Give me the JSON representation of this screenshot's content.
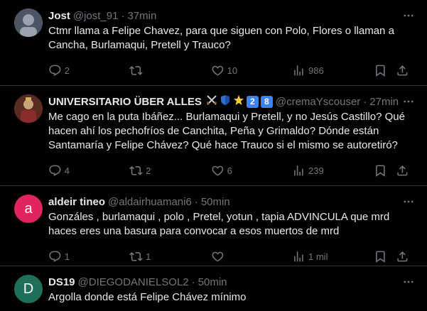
{
  "tweets": [
    {
      "avatar_color": "#6b7280",
      "name": "Jost",
      "handle": "@jost_91",
      "time": "37min",
      "text": "Ctmr llama a Felipe Chavez, para que siguen con Polo, Flores o llaman a Cancha, Burlamaqui, Pretell y Trauco?",
      "replies": "2",
      "retweets": "",
      "likes": "10",
      "views": "986"
    },
    {
      "avatar_color": "#7a3b2e",
      "name": "UNIVERSITARIO ÜBER ALLES",
      "badges": [
        "crossed-swords-icon",
        "shield-icon",
        "star-icon"
      ],
      "badge_nums": [
        "2",
        "8"
      ],
      "handle": "@cremaYscouser",
      "time": "27min",
      "text": "Me cago en la puta Ibáñez... Burlamaqui y Pretell, y no Jesús Castillo?  Qué hacen ahí los pechofríos de Canchita, Peña y Grimaldo? Dónde están Santamaría y Felipe Chávez? Qué hace Trauco si el mismo se autoretiró?",
      "replies": "4",
      "retweets": "2",
      "likes": "6",
      "views": "239"
    },
    {
      "avatar_color": "#e0245e",
      "avatar_letter": "a",
      "name": "aldeir tineo",
      "handle": "@aldairhuamani6",
      "time": "50min",
      "text": "Gonzáles , burlamaqui , polo , Pretel, yotun , tapia  ADVINCULA  que mrd haces eres una basura para convocar a esos muertos de mrd",
      "replies": "1",
      "retweets": "1",
      "likes": "",
      "views": "1 mil"
    },
    {
      "avatar_color": "#1f6f5a",
      "avatar_letter": "D",
      "name": "DS19",
      "handle": "@DIEGODANIELSOL2",
      "time": "50min",
      "text": "Argolla donde está Felipe Chávez mínimo"
    }
  ]
}
